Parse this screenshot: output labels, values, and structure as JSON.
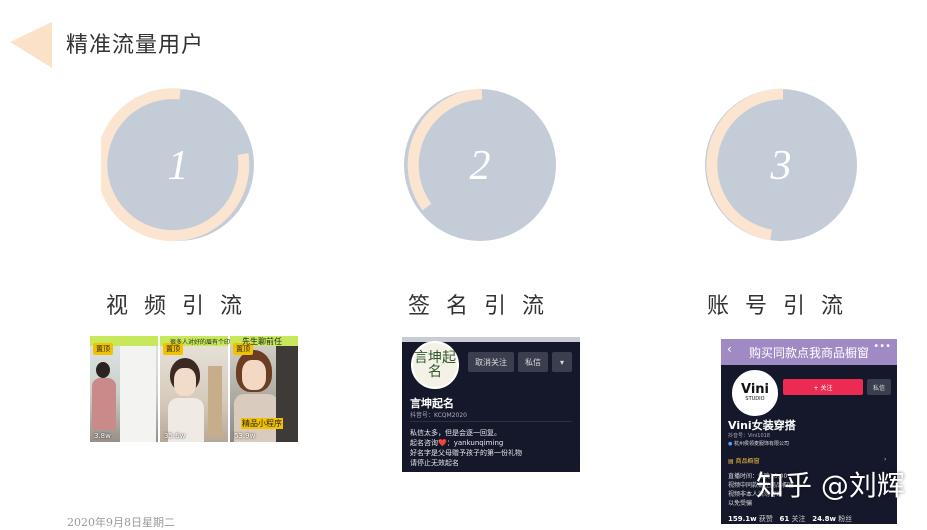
{
  "page": {
    "title": "精准流量用户",
    "date": "2020年9月8日星期二"
  },
  "colors": {
    "circle_fill": "#c4ccd8",
    "ring": "#fbe5d0",
    "triangle": "#fbe1c8"
  },
  "steps": [
    {
      "number": "1",
      "label": "视频引流"
    },
    {
      "number": "2",
      "label": "签名引流"
    },
    {
      "number": "3",
      "label": "账号引流"
    }
  ],
  "video_shot": {
    "cells": [
      {
        "badge": "置顶",
        "likes": "3.8w"
      },
      {
        "badge": "置顶",
        "likes": "35.6w"
      },
      {
        "badge": "置顶",
        "likes": "53.9w"
      }
    ],
    "captions": [
      "很多人对好的眉有个印",
      "先生聊前任",
      "精品小程序"
    ]
  },
  "profile_shot": {
    "avatar_text": "言坤起名",
    "unfollow": "取消关注",
    "message": "私信",
    "name": "言坤起名",
    "id": "抖音号：KCQM2020",
    "bio": [
      "私信太多，但是会逐一回复。",
      "起名咨询❤️：yankunqiming",
      "好名字是父母赠予孩子的第一份礼物",
      "请停止无效起名"
    ]
  },
  "shop_shot": {
    "banner": "购买同款点我商品橱窗",
    "avatar_big": "Vini",
    "avatar_small": "STUDIO",
    "follow": "+ 关注",
    "message": "私信",
    "name": "Vini女装穿搭",
    "id": "抖音号：Vini1018",
    "company": "杭州侯领麦服饰有限公司",
    "shop_link": "商品橱窗",
    "lines": [
      "直播时间：每晚10:00",
      "视频中同款都在商品橱窗",
      "视频非本人请勿咨询",
      "以免受骗"
    ],
    "stats": {
      "likes": "159.1w",
      "likes_label": "获赞",
      "following": "61",
      "following_label": "关注",
      "fans": "24.8w",
      "fans_label": "粉丝"
    }
  },
  "watermark": "知乎 @刘辉"
}
